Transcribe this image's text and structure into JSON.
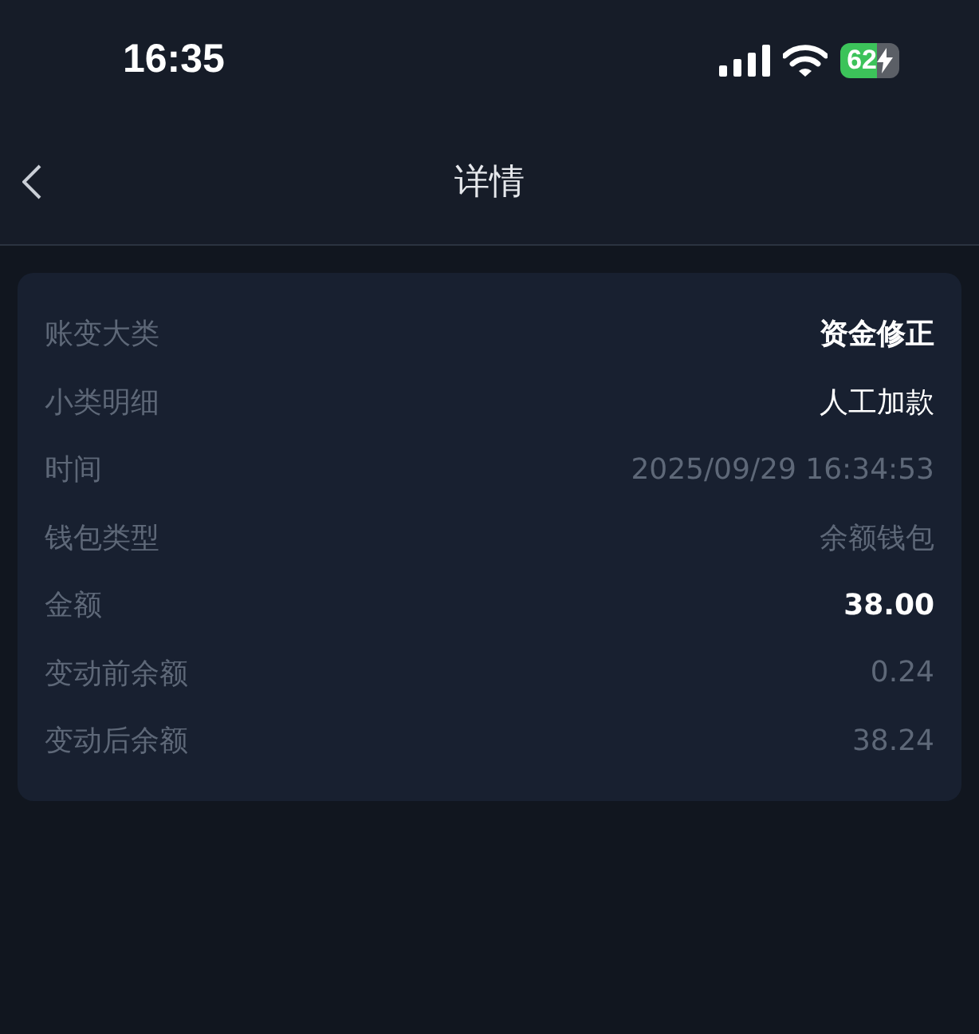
{
  "status_bar": {
    "time": "16:35",
    "battery": "62"
  },
  "nav": {
    "title": "详情"
  },
  "rows": [
    {
      "label": "账变大类",
      "value": "资金修正",
      "kind": "emphasis"
    },
    {
      "label": "小类明细",
      "value": "人工加款",
      "kind": "plain"
    },
    {
      "label": "时间",
      "value": "2025/09/29 16:34:53",
      "kind": "muted"
    },
    {
      "label": "钱包类型",
      "value": "余额钱包",
      "kind": "muted"
    },
    {
      "label": "金额",
      "value": "38.00",
      "kind": "emphasis"
    },
    {
      "label": "变动前余额",
      "value": "0.24",
      "kind": "muted"
    },
    {
      "label": "变动后余额",
      "value": "38.24",
      "kind": "muted"
    }
  ]
}
